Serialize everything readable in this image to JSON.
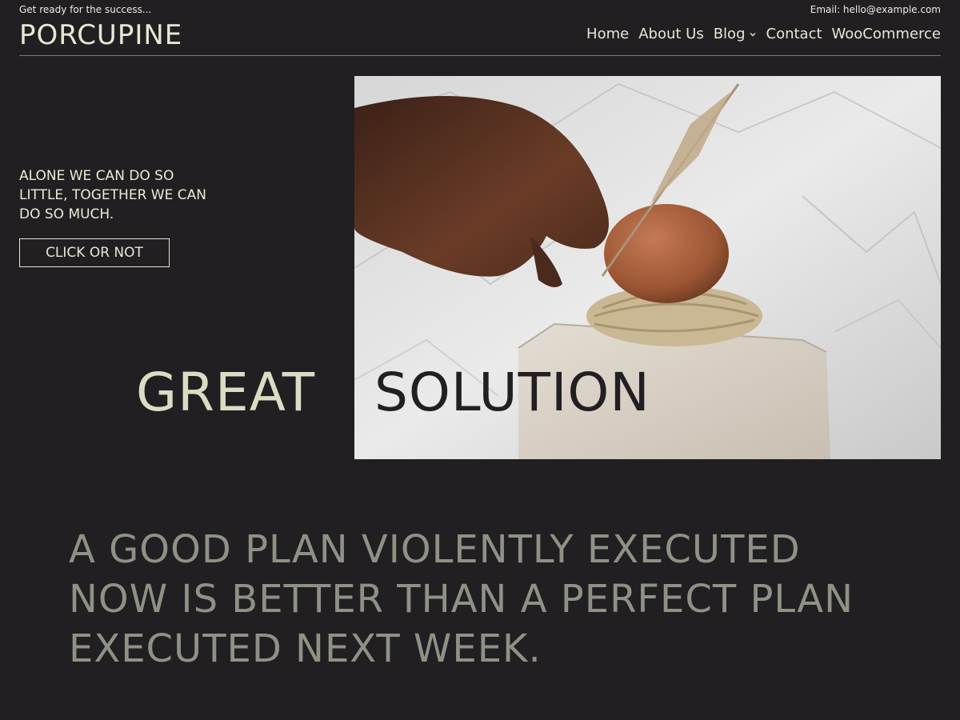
{
  "header": {
    "tagline": "Get ready for the success...",
    "email": "Email: hello@example.com",
    "logo": "PORCUPINE",
    "nav": {
      "home": "Home",
      "about": "About Us",
      "blog": "Blog",
      "contact": "Contact",
      "woocommerce": "WooCommerce"
    }
  },
  "hero": {
    "quote": "ALONE WE CAN DO SO LITTLE, TOGETHER WE CAN DO SO MUCH.",
    "button_label": "CLICK OR NOT",
    "headline_left": "GREAT",
    "headline_right": "SOLUTION",
    "image_icon": "hand-egg-wheat-photo-icon"
  },
  "feature": {
    "quote": "A GOOD PLAN VIOLENTLY EXECUTED NOW IS BETTER THAN A PERFECT PLAN EXECUTED NEXT WEEK."
  },
  "colors": {
    "background": "#211f22",
    "accent_text": "#e8e6d6",
    "muted_quote": "#8f9185"
  }
}
